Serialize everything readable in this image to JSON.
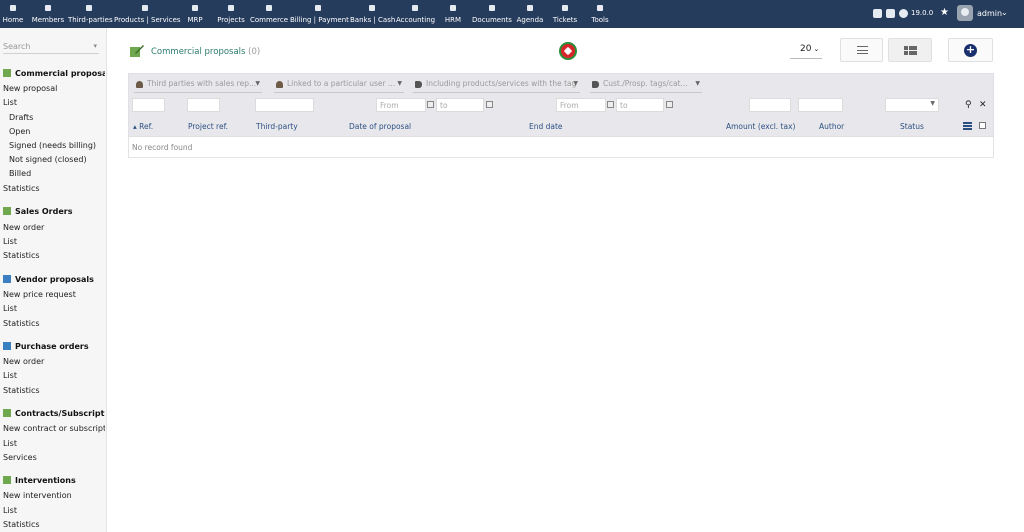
{
  "topbar": {
    "menu": [
      {
        "label": "Home",
        "icon": "home-icon"
      },
      {
        "label": "Members",
        "icon": "members-icon"
      },
      {
        "label": "Third-parties",
        "icon": "building-icon"
      },
      {
        "label": "Products | Services",
        "icon": "cube-icon"
      },
      {
        "label": "MRP",
        "icon": "cubes-icon"
      },
      {
        "label": "Projects",
        "icon": "sitemap-icon"
      },
      {
        "label": "Commerce",
        "icon": "briefcase-icon"
      },
      {
        "label": "Billing | Payment",
        "icon": "credit-card-icon"
      },
      {
        "label": "Banks | Cash",
        "icon": "bank-icon"
      },
      {
        "label": "Accounting",
        "icon": "search-dollar-icon"
      },
      {
        "label": "HRM",
        "icon": "user-tie-icon"
      },
      {
        "label": "Documents",
        "icon": "folder-icon"
      },
      {
        "label": "Agenda",
        "icon": "calendar-icon"
      },
      {
        "label": "Tickets",
        "icon": "ticket-icon"
      },
      {
        "label": "Tools",
        "icon": "tools-icon"
      }
    ],
    "version": "19.0.0",
    "username": "admin"
  },
  "sidebar": {
    "search_placeholder": "Search",
    "sections": [
      {
        "title": "Commercial proposals",
        "links": [
          "New proposal",
          "List"
        ],
        "sub": [
          "Drafts",
          "Open",
          "Signed (needs billing)",
          "Not signed (closed)",
          "Billed"
        ],
        "after": [
          "Statistics"
        ]
      },
      {
        "title": "Sales Orders",
        "links": [
          "New order",
          "List",
          "Statistics"
        ]
      },
      {
        "title": "Vendor proposals",
        "links": [
          "New price request",
          "List",
          "Statistics"
        ]
      },
      {
        "title": "Purchase orders",
        "links": [
          "New order",
          "List",
          "Statistics"
        ]
      },
      {
        "title": "Contracts/Subscriptions",
        "links": [
          "New contract or subscription",
          "List",
          "Services"
        ]
      },
      {
        "title": "Interventions",
        "links": [
          "New intervention",
          "List",
          "Statistics"
        ]
      }
    ]
  },
  "main": {
    "title": "Commercial proposals",
    "count": "(0)",
    "limit": "20",
    "filters": {
      "sales_rep": "Third parties with sales rep...",
      "linked_user": "Linked to a particular user ...",
      "products_tag": "Including products/services with the tag",
      "cust_tags": "Cust./Prosp. tags/cat...",
      "from1": "From",
      "to1": "to",
      "from2": "From",
      "to2": "to"
    },
    "columns": [
      "Ref.",
      "Project ref.",
      "Third-party",
      "Date of proposal",
      "End date",
      "Amount (excl. tax)",
      "Author",
      "Status"
    ],
    "empty": "No record found"
  }
}
